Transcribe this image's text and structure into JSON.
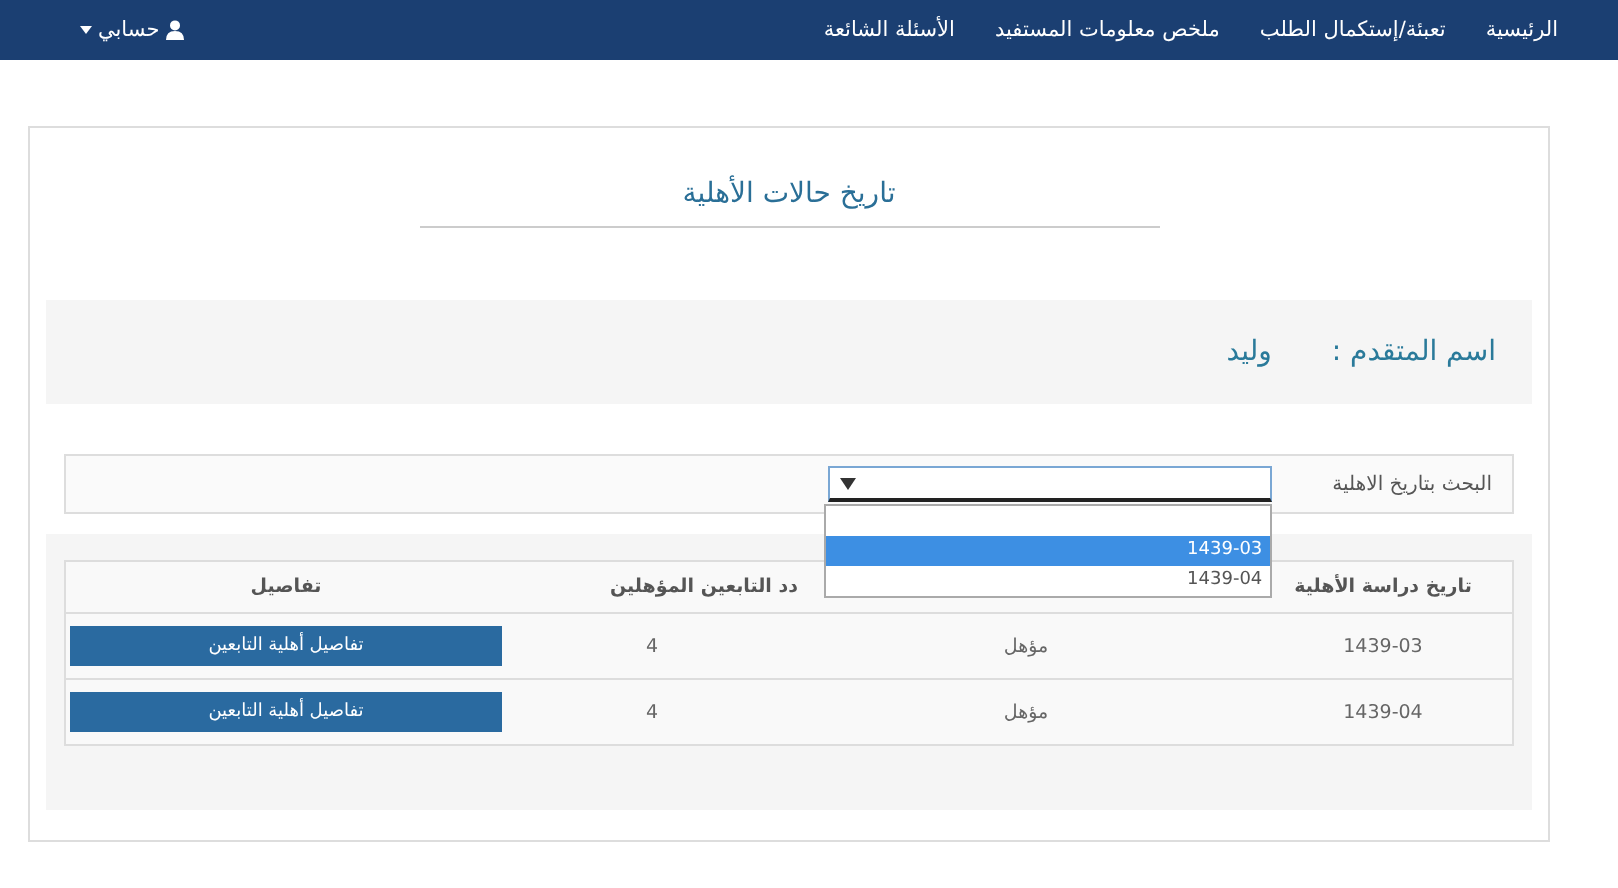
{
  "navbar": {
    "links": [
      {
        "label": "الرئيسية"
      },
      {
        "label": "تعبئة/إستكمال الطلب"
      },
      {
        "label": "ملخص معلومات المستفيد"
      },
      {
        "label": "الأسئلة الشائعة"
      }
    ],
    "account": {
      "label": "حسابي"
    }
  },
  "page": {
    "title": "تاريخ حالات الأهلية",
    "applicant_label": "اسم المتقدم :",
    "applicant_name": "وليد"
  },
  "search": {
    "label": "البحث بتاريخ الاهلية",
    "dropdown": {
      "expanded": true,
      "options": [
        {
          "label": "1439-03",
          "selected": true
        },
        {
          "label": "1439-04",
          "selected": false
        }
      ]
    }
  },
  "table": {
    "columns": [
      "تاريخ دراسة الأهلية",
      "",
      "دد التابعين المؤهلين",
      "تفاصيل"
    ],
    "rows": [
      {
        "date": "1439-03",
        "status": "مؤهل",
        "count": "4",
        "action": "تفاصيل أهلية التابعين"
      },
      {
        "date": "1439-04",
        "status": "مؤهل",
        "count": "4",
        "action": "تفاصيل أهلية التابعين"
      }
    ]
  }
}
